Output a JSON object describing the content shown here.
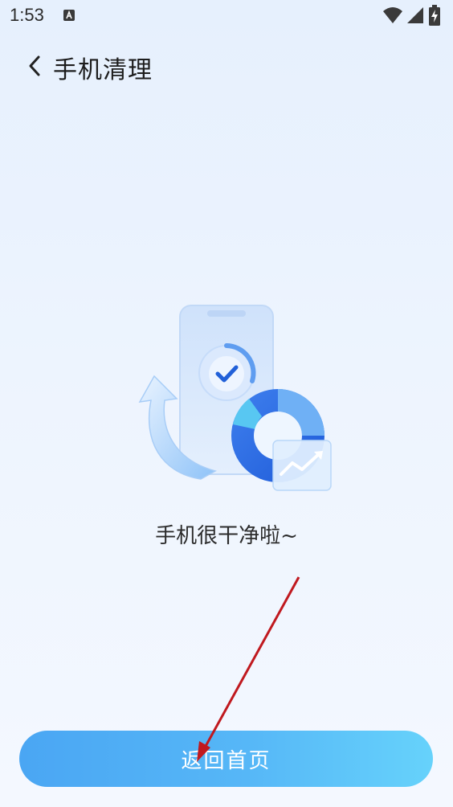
{
  "status_bar": {
    "time": "1:53",
    "app_icon": "a-badge-icon",
    "icons": [
      "wifi-icon",
      "signal-icon",
      "battery-charging-icon"
    ]
  },
  "header": {
    "back_icon": "chevron-left-icon",
    "title": "手机清理"
  },
  "main": {
    "illustration": "phone-clean-success-illustration",
    "message": "手机很干净啦~"
  },
  "footer": {
    "home_button_label": "返回首页"
  },
  "colors": {
    "accent": "#4aa6f3",
    "accent_end": "#66d2fb",
    "annotation_arrow": "#c0191f"
  }
}
